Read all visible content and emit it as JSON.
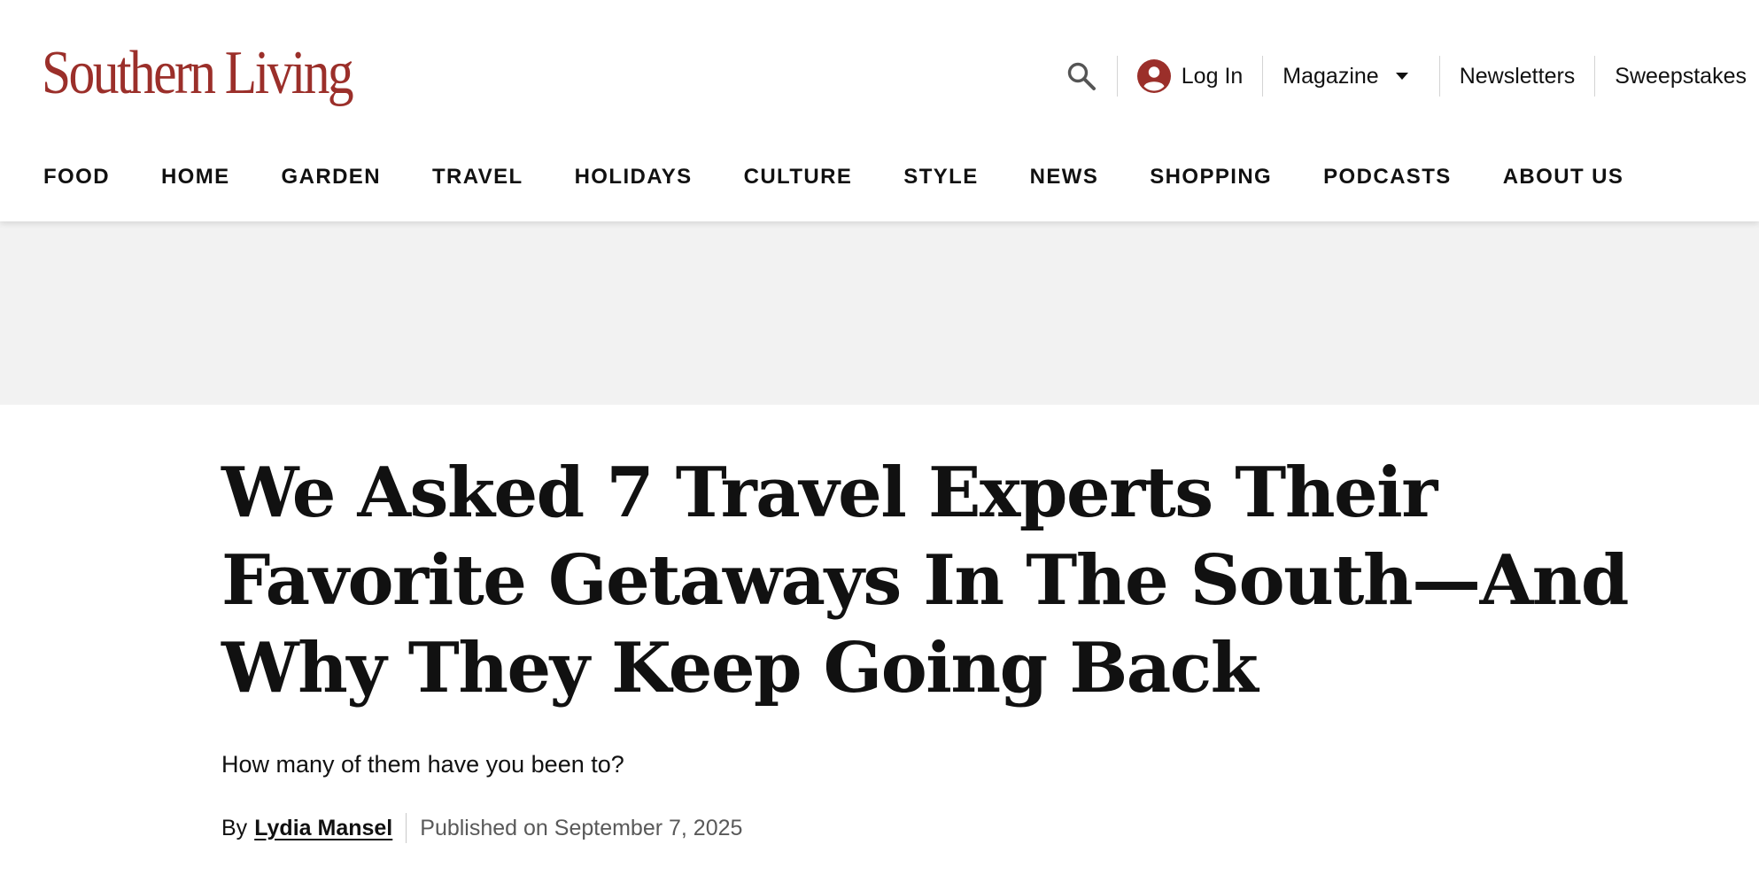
{
  "header": {
    "logo_text": "Southern Living",
    "utility": {
      "search_icon": "search-icon",
      "login_icon": "user-circle-icon",
      "login_label": "Log In",
      "magazine_label": "Magazine",
      "magazine_icon": "caret-down-icon",
      "newsletters_label": "Newsletters",
      "sweepstakes_label": "Sweepstakes"
    },
    "nav": [
      "FOOD",
      "HOME",
      "GARDEN",
      "TRAVEL",
      "HOLIDAYS",
      "CULTURE",
      "STYLE",
      "NEWS",
      "SHOPPING",
      "PODCASTS",
      "ABOUT US"
    ]
  },
  "article": {
    "headline": "We Asked 7 Travel Experts Their Favorite Getaways In The South—And Why They Keep Going Back",
    "dek": "How many of them have you been to?",
    "byline": {
      "by": "By",
      "author": "Lydia Mansel",
      "published": "Published on September 7, 2025"
    }
  },
  "colors": {
    "brand": "#9b2f2a",
    "text": "#111111",
    "muted": "#595959",
    "ad_background": "#f2f2f2"
  }
}
